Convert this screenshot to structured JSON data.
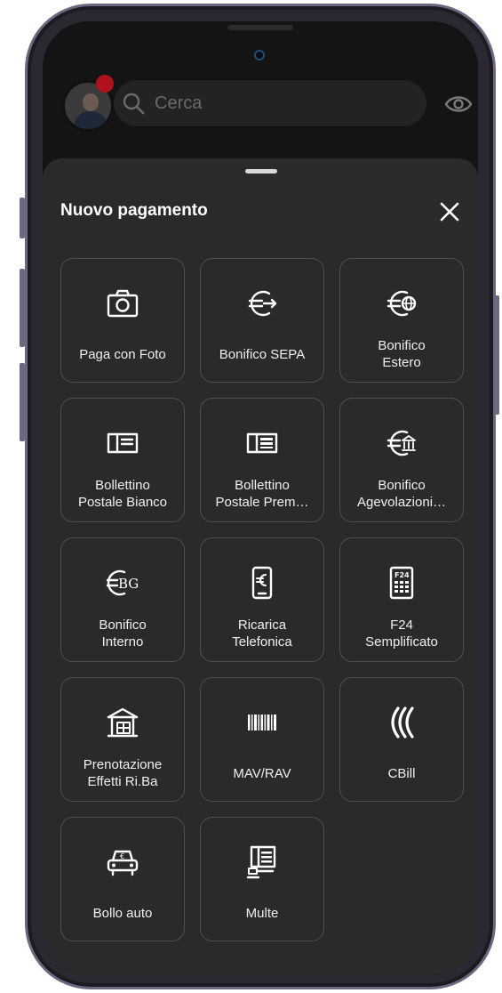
{
  "header": {
    "search_placeholder": "Cerca"
  },
  "sheet": {
    "title": "Nuovo pagamento",
    "items": [
      {
        "label": "Paga con Foto",
        "icon": "camera-icon"
      },
      {
        "label": "Bonifico SEPA",
        "icon": "euro-transfer-icon"
      },
      {
        "label": "Bonifico\nEstero",
        "icon": "euro-globe-icon"
      },
      {
        "label": "Bollettino\nPostale Bianco",
        "icon": "postal-slip-icon"
      },
      {
        "label": "Bollettino\nPostale Prem…",
        "icon": "postal-slip-prefilled-icon"
      },
      {
        "label": "Bonifico\nAgevolazioni…",
        "icon": "euro-bank-icon"
      },
      {
        "label": "Bonifico\nInterno",
        "icon": "euro-bg-icon"
      },
      {
        "label": "Ricarica\nTelefonica",
        "icon": "phone-euro-icon"
      },
      {
        "label": "F24\nSemplificato",
        "icon": "f24-form-icon"
      },
      {
        "label": "Prenotazione\nEffetti Ri.Ba",
        "icon": "warehouse-icon"
      },
      {
        "label": "MAV/RAV",
        "icon": "barcode-icon"
      },
      {
        "label": "CBill",
        "icon": "cbill-icon"
      },
      {
        "label": "Bollo auto",
        "icon": "car-icon"
      },
      {
        "label": "Multe",
        "icon": "fine-ticket-icon"
      }
    ]
  }
}
